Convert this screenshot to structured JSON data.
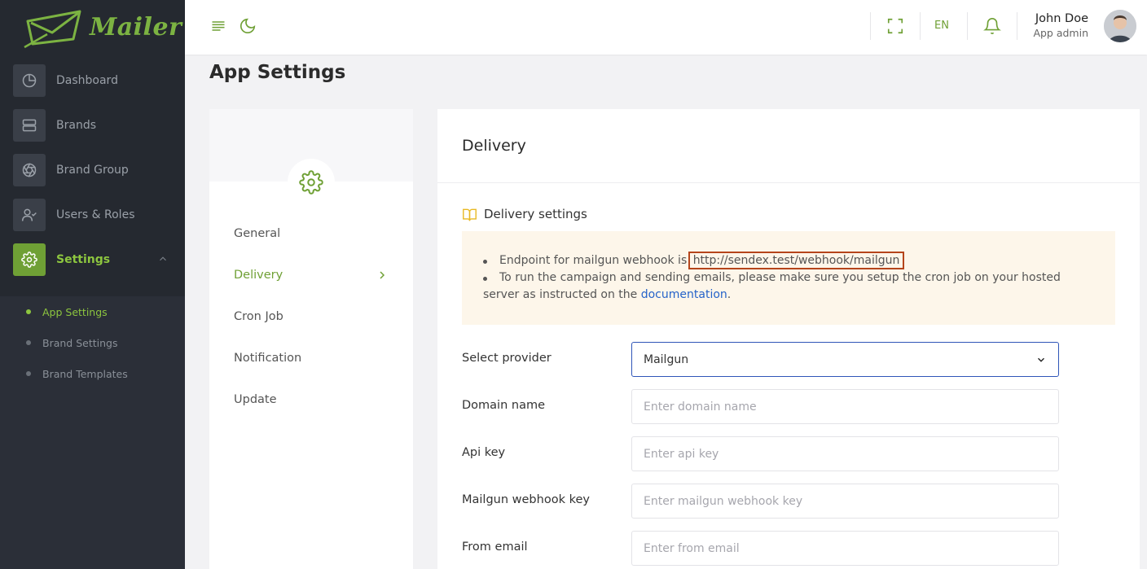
{
  "app": {
    "logo_text": "Mailer"
  },
  "sidebar": {
    "items": [
      {
        "label": "Dashboard",
        "icon": "pie-chart-icon"
      },
      {
        "label": "Brands",
        "icon": "server-icon"
      },
      {
        "label": "Brand Group",
        "icon": "aperture-icon"
      },
      {
        "label": "Users & Roles",
        "icon": "user-check-icon"
      },
      {
        "label": "Settings",
        "icon": "gear-icon",
        "active": true
      }
    ],
    "subitems": [
      {
        "label": "App Settings",
        "active": true
      },
      {
        "label": "Brand Settings"
      },
      {
        "label": "Brand Templates"
      }
    ]
  },
  "topbar": {
    "language": "EN",
    "user_name": "John Doe",
    "user_role": "App admin"
  },
  "page": {
    "title": "App Settings"
  },
  "settings_menu": {
    "items": [
      {
        "label": "General"
      },
      {
        "label": "Delivery",
        "active": true
      },
      {
        "label": "Cron Job"
      },
      {
        "label": "Notification"
      },
      {
        "label": "Update"
      }
    ]
  },
  "content": {
    "title": "Delivery",
    "section_title": "Delivery settings",
    "notice": {
      "line1_prefix": "Endpoint for mailgun webhook is",
      "webhook_url": "http://sendex.test/webhook/mailgun",
      "line2_prefix": "To run the campaign and sending emails, please make sure you setup the cron job on your hosted",
      "line2_cont": "server as instructed on the",
      "link_text": "documentation",
      "line2_suffix": "."
    },
    "form": {
      "provider_label": "Select provider",
      "provider_value": "Mailgun",
      "domain_label": "Domain name",
      "domain_placeholder": "Enter domain name",
      "api_label": "Api key",
      "api_placeholder": "Enter api key",
      "webhook_label": "Mailgun webhook key",
      "webhook_placeholder": "Enter mailgun webhook key",
      "from_label": "From email",
      "from_placeholder": "Enter from email"
    }
  },
  "colors": {
    "accent": "#6fa035",
    "sidebar_bg": "#2b2f38",
    "highlight_box": "#b5451b",
    "notice_bg": "#fdf6ea"
  }
}
